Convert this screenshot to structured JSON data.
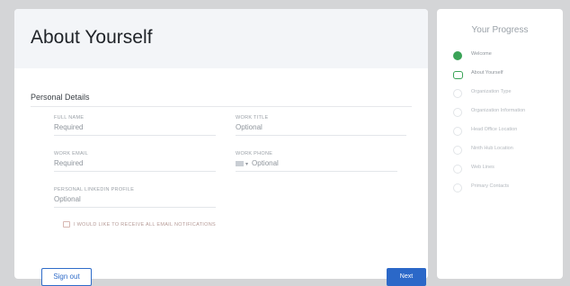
{
  "page": {
    "title": "About Yourself",
    "section": "Personal Details"
  },
  "fields": [
    {
      "label": "FULL NAME",
      "value": "Required"
    },
    {
      "label": "WORK TITLE",
      "value": "Optional"
    },
    {
      "label": "WORK EMAIL",
      "value": "Required"
    },
    {
      "label": "WORK PHONE",
      "value": "Optional"
    },
    {
      "label": "PERSONAL LINKEDIN PROFILE",
      "value": "Optional"
    }
  ],
  "notice": "I WOULD LIKE TO RECEIVE ALL EMAIL NOTIFICATIONS",
  "actions": {
    "signout": "Sign out",
    "next": "Next"
  },
  "progress": {
    "title": "Your Progress",
    "steps": [
      {
        "label": "Welcome",
        "state": "done"
      },
      {
        "label": "About Yourself",
        "state": "current"
      },
      {
        "label": "Organization Type",
        "state": "pending"
      },
      {
        "label": "Organization Information",
        "state": "pending"
      },
      {
        "label": "Head Office Location",
        "state": "pending"
      },
      {
        "label": "Ninth Hub Location",
        "state": "pending"
      },
      {
        "label": "Web Lines",
        "state": "pending"
      },
      {
        "label": "Primary Contacts",
        "state": "pending"
      }
    ]
  },
  "colors": {
    "accent": "#2b68c8",
    "success": "#3aa357",
    "background": "#d4d5d7"
  }
}
